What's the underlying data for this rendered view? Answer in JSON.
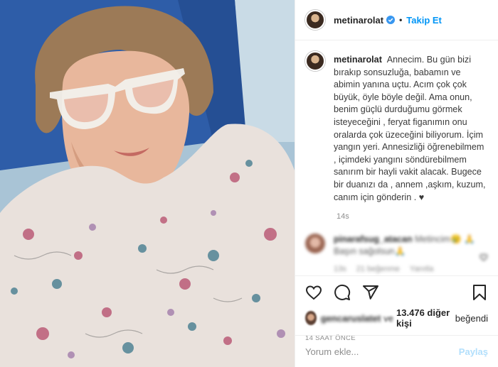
{
  "colors": {
    "accent": "#0095f6",
    "muted": "#8e8e8e",
    "text": "#262626",
    "post_disabled": "#b2dffc"
  },
  "header": {
    "username": "metinarolat",
    "separator": "•",
    "follow_label": "Takip Et"
  },
  "caption": {
    "username": "metinarolat",
    "text": "Annecim. Bu gün bizi bırakıp sonsuzluğa, babamın ve abimin yanına uçtu. Acım çok çok büyük, öyle böyle değil. Ama onun, benim güçlü durduğumu görmek isteyeceğini , feryat figanımın onu oralarda çok üzeceğini biliyorum. İçim yangın yeri. Annesizliği öğrenebilmem , içimdeki yangını söndürebilmem sanırım bir hayli vakit alacak. Bugece bir duanızı da , annem ,aşkım, kuzum, canım için gönderin . ♥",
    "time": "14s"
  },
  "comment": {
    "username": "pinarafsug_atacan",
    "text": "Metincim😢 🙏Başın sağolsun🙏",
    "time": "13s",
    "likes": "21 beğenme",
    "reply": "Yanıtla"
  },
  "icons": [
    "heart-icon",
    "comment-icon",
    "share-icon",
    "bookmark-icon",
    "verified-icon"
  ],
  "likes": {
    "name": "gencaruslatet",
    "ve": "ve",
    "count_text": "13.476 diğer kişi",
    "suffix": "beğendi"
  },
  "posted_ago": "14 SAAT ÖNCE",
  "comment_box": {
    "placeholder": "Yorum ekle...",
    "post_label": "Paylaş"
  }
}
